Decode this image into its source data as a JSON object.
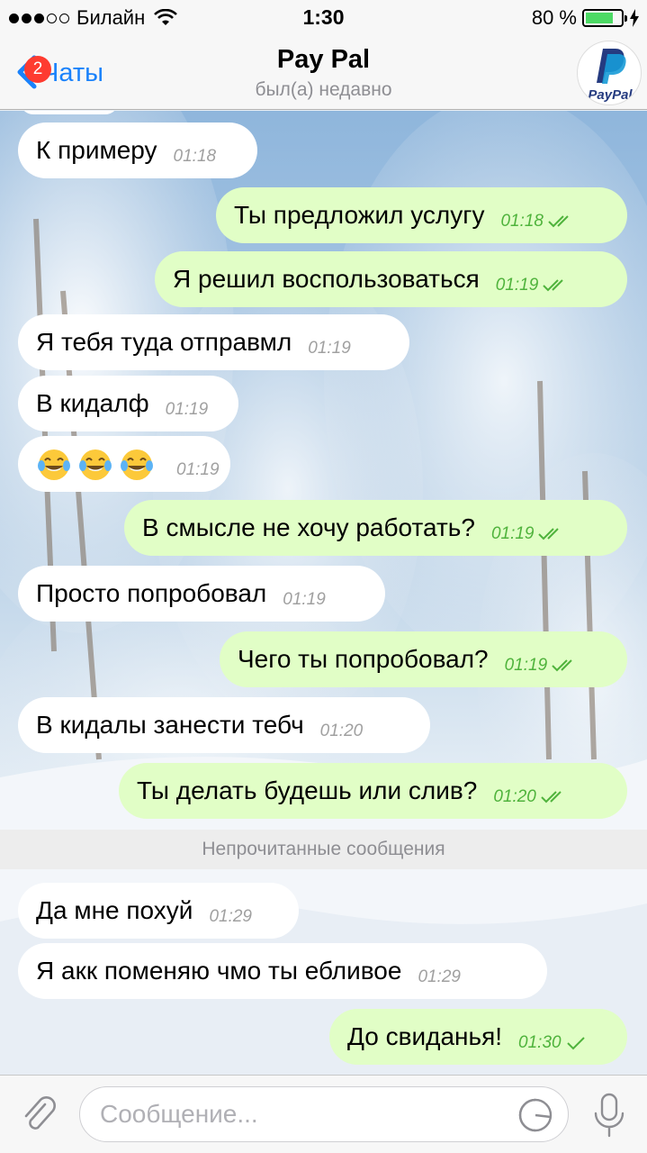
{
  "status_bar": {
    "carrier": "Билайн",
    "time": "1:30",
    "battery_text": "80 %",
    "battery_level": 0.8
  },
  "header": {
    "back_label": "Чаты",
    "back_badge": "2",
    "title": "Pay Pal",
    "subtitle": "был(а) недавно",
    "avatar_text": "PayPal"
  },
  "messages": [
    {
      "dir": "in",
      "text": "К примеру",
      "time": "01:18"
    },
    {
      "dir": "out",
      "text": "Ты предложил услугу",
      "time": "01:18",
      "status": "read"
    },
    {
      "dir": "out",
      "text": "Я решил воспользоваться",
      "time": "01:19",
      "status": "read"
    },
    {
      "dir": "in",
      "text": "Я тебя туда отправмл",
      "time": "01:19"
    },
    {
      "dir": "in",
      "text": "В кидалф",
      "time": "01:19"
    },
    {
      "dir": "in",
      "text": "😂😂😂",
      "time": "01:19",
      "emoji_count": 3
    },
    {
      "dir": "out",
      "text": "В смысле не хочу работать?",
      "time": "01:19",
      "status": "read"
    },
    {
      "dir": "in",
      "text": "Просто попробовал",
      "time": "01:19"
    },
    {
      "dir": "out",
      "text": "Чего ты попробовал?",
      "time": "01:19",
      "status": "read"
    },
    {
      "dir": "in",
      "text": "В кидалы занести тебч",
      "time": "01:20"
    },
    {
      "dir": "out",
      "text": "Ты делать будешь или слив?",
      "time": "01:20",
      "status": "read"
    },
    {
      "dir": "in",
      "text": "Да мне похуй",
      "time": "01:29"
    },
    {
      "dir": "in",
      "text": "Я акк поменяю чмо ты ебливое",
      "time": "01:29"
    },
    {
      "dir": "out",
      "text": "До свиданья!",
      "time": "01:30",
      "status": "delivered"
    }
  ],
  "unread_separator": "Непрочитанные сообщения",
  "composer": {
    "placeholder": "Сообщение..."
  },
  "colors": {
    "accent": "#1a82fb",
    "outgoing_bubble": "#e1fec6",
    "incoming_bubble": "#ffffff",
    "read_ticks": "#4fb33c",
    "badge": "#fe3b30"
  }
}
